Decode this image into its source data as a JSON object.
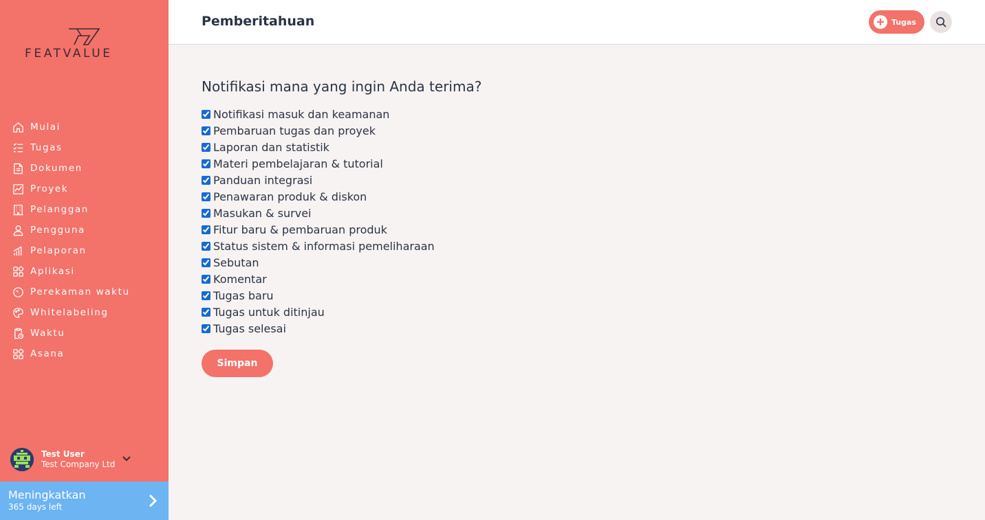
{
  "brand": {
    "logo_text": "FEATVALUE"
  },
  "sidebar": {
    "items": [
      {
        "label": "Mulai",
        "icon": "home-icon"
      },
      {
        "label": "Tugas",
        "icon": "task-list-icon"
      },
      {
        "label": "Dokumen",
        "icon": "document-icon"
      },
      {
        "label": "Proyek",
        "icon": "project-chart-icon"
      },
      {
        "label": "Pelanggan",
        "icon": "building-icon"
      },
      {
        "label": "Pengguna",
        "icon": "user-icon"
      },
      {
        "label": "Pelaporan",
        "icon": "report-bars-icon"
      },
      {
        "label": "Aplikasi",
        "icon": "apps-grid-icon"
      },
      {
        "label": "Perekaman waktu",
        "icon": "timer-icon"
      },
      {
        "label": "Whitelabeling",
        "icon": "palette-icon"
      },
      {
        "label": "Waktu",
        "icon": "clipboard-clock-icon"
      },
      {
        "label": "Asana",
        "icon": "apps-grid-icon"
      }
    ]
  },
  "user": {
    "name": "Test User",
    "company": "Test Company Ltd"
  },
  "upgrade": {
    "title": "Meningkatkan",
    "subtitle": "365 days left"
  },
  "header": {
    "title": "Pemberitahuan",
    "task_button": "Tugas"
  },
  "main": {
    "question": "Notifikasi mana yang ingin Anda terima?",
    "options": [
      {
        "label": "Notifikasi masuk dan keamanan",
        "checked": true
      },
      {
        "label": "Pembaruan tugas dan proyek",
        "checked": true
      },
      {
        "label": "Laporan dan statistik",
        "checked": true
      },
      {
        "label": "Materi pembelajaran & tutorial",
        "checked": true
      },
      {
        "label": "Panduan integrasi",
        "checked": true
      },
      {
        "label": "Penawaran produk & diskon",
        "checked": true
      },
      {
        "label": "Masukan & survei",
        "checked": true
      },
      {
        "label": "Fitur baru & pembaruan produk",
        "checked": true
      },
      {
        "label": "Status sistem & informasi pemeliharaan",
        "checked": true
      },
      {
        "label": "Sebutan",
        "checked": true
      },
      {
        "label": "Komentar",
        "checked": true
      },
      {
        "label": "Tugas baru",
        "checked": true
      },
      {
        "label": "Tugas untuk ditinjau",
        "checked": true
      },
      {
        "label": "Tugas selesai",
        "checked": true
      }
    ],
    "save_label": "Simpan"
  },
  "colors": {
    "sidebar": "#f3726a",
    "accent": "#f3726a",
    "upgrade": "#6cb4f2",
    "background": "#f7f3f2"
  }
}
